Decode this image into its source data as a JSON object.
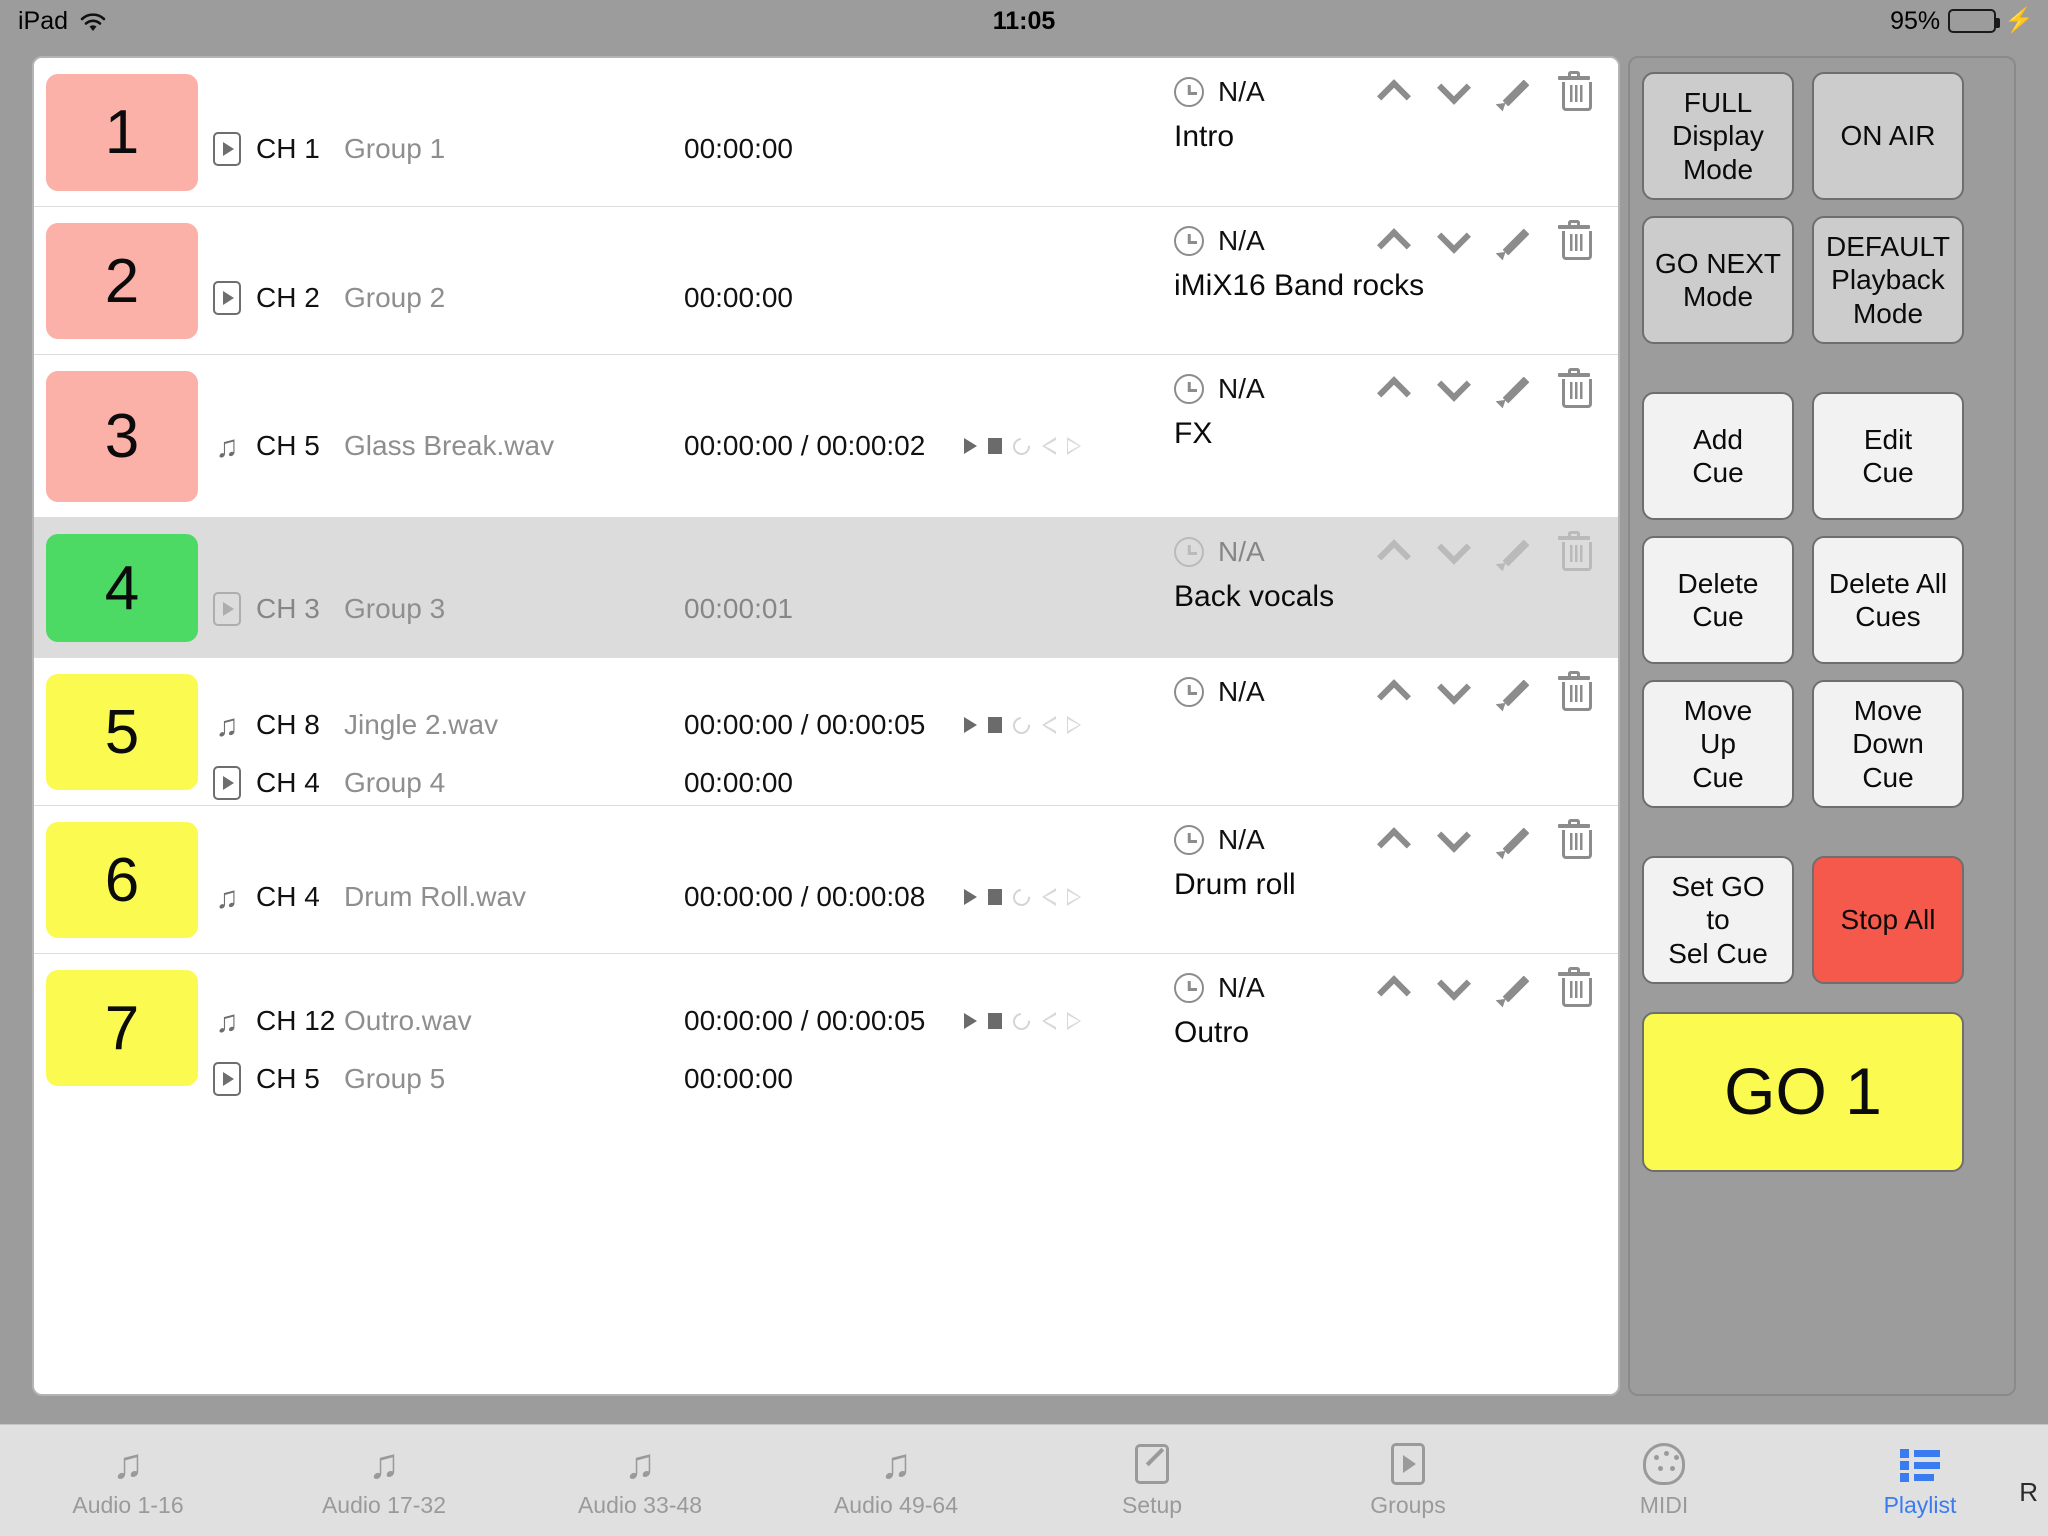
{
  "status_bar": {
    "device": "iPad",
    "wifi_icon": "wifi-icon",
    "time": "11:05",
    "battery_percent": "95%",
    "battery_level": 95,
    "charging_icon": "lightning-bolt-icon",
    "battery_color": "#4cd964"
  },
  "colors": {
    "cue_pink": "#fbb0a8",
    "cue_green": "#4cd964",
    "cue_yellow": "#fafa50",
    "selected_row": "#dcdcdc",
    "stop_all_red": "#f5594b",
    "go_yellow": "#fafa50",
    "active_tab_blue": "#3a7bf0",
    "mode_button_gray": "#cccccc",
    "panel_background": "#9c9c9c"
  },
  "playlist": {
    "rows": [
      {
        "number": "1",
        "badge_color": "#fbb0a8",
        "selected": false,
        "lines": [
          {
            "icon": "video-icon",
            "channel": "CH 1",
            "source": "Group 1",
            "time": "00:00:00",
            "transport": false
          }
        ],
        "schedule_icon": "clock-icon",
        "schedule": "N/A",
        "cue_name": "Intro",
        "actions": [
          "move-up-icon",
          "move-down-icon",
          "edit-icon",
          "delete-icon"
        ]
      },
      {
        "number": "2",
        "badge_color": "#fbb0a8",
        "selected": false,
        "lines": [
          {
            "icon": "video-icon",
            "channel": "CH 2",
            "source": "Group 2",
            "time": "00:00:00",
            "transport": false
          }
        ],
        "schedule_icon": "clock-icon",
        "schedule": "N/A",
        "cue_name": "iMiX16 Band rocks",
        "actions": [
          "move-up-icon",
          "move-down-icon",
          "edit-icon",
          "delete-icon"
        ]
      },
      {
        "number": "3",
        "badge_color": "#fbb0a8",
        "selected": false,
        "lines": [
          {
            "icon": "music-note-icon",
            "channel": "CH 5",
            "source": "Glass Break.wav",
            "time": "00:00:00 / 00:00:02",
            "transport": true
          }
        ],
        "schedule_icon": "clock-icon",
        "schedule": "N/A",
        "cue_name": "FX",
        "actions": [
          "move-up-icon",
          "move-down-icon",
          "edit-icon",
          "delete-icon"
        ]
      },
      {
        "number": "4",
        "badge_color": "#4cd964",
        "selected": true,
        "lines": [
          {
            "icon": "video-icon",
            "channel": "CH 3",
            "source": "Group 3",
            "time": "00:00:01",
            "transport": false
          }
        ],
        "schedule_icon": "clock-icon",
        "schedule": "N/A",
        "cue_name": "Back vocals",
        "actions": [
          "move-up-icon",
          "move-down-icon",
          "edit-icon",
          "delete-icon"
        ]
      },
      {
        "number": "5",
        "badge_color": "#fafa50",
        "selected": false,
        "lines": [
          {
            "icon": "music-note-icon",
            "channel": "CH 8",
            "source": "Jingle 2.wav",
            "time": "00:00:00 / 00:00:05",
            "transport": true
          },
          {
            "icon": "video-icon",
            "channel": "CH 4",
            "source": "Group 4",
            "time": "00:00:00",
            "transport": false
          }
        ],
        "schedule_icon": "clock-icon",
        "schedule": "N/A",
        "cue_name": "",
        "actions": [
          "move-up-icon",
          "move-down-icon",
          "edit-icon",
          "delete-icon"
        ]
      },
      {
        "number": "6",
        "badge_color": "#fafa50",
        "selected": false,
        "lines": [
          {
            "icon": "music-note-icon",
            "channel": "CH 4",
            "source": "Drum Roll.wav",
            "time": "00:00:00 / 00:00:08",
            "transport": true
          }
        ],
        "schedule_icon": "clock-icon",
        "schedule": "N/A",
        "cue_name": "Drum roll",
        "actions": [
          "move-up-icon",
          "move-down-icon",
          "edit-icon",
          "delete-icon"
        ]
      },
      {
        "number": "7",
        "badge_color": "#fafa50",
        "selected": false,
        "lines": [
          {
            "icon": "music-note-icon",
            "channel": "CH 12",
            "source": "Outro.wav",
            "time": "00:00:00 / 00:00:05",
            "transport": true
          },
          {
            "icon": "video-icon",
            "channel": "CH 5",
            "source": "Group 5",
            "time": "00:00:00",
            "transport": false
          }
        ],
        "schedule_icon": "clock-icon",
        "schedule": "N/A",
        "cue_name": "Outro",
        "actions": [
          "move-up-icon",
          "move-down-icon",
          "edit-icon",
          "delete-icon"
        ]
      }
    ]
  },
  "sidebar": {
    "mode_buttons": [
      {
        "label": "FULL\nDisplay\nMode"
      },
      {
        "label": "ON AIR"
      },
      {
        "label": "GO NEXT\nMode"
      },
      {
        "label": "DEFAULT\nPlayback\nMode"
      }
    ],
    "cue_buttons": [
      {
        "label": "Add\nCue"
      },
      {
        "label": "Edit\nCue"
      },
      {
        "label": "Delete\nCue"
      },
      {
        "label": "Delete All\nCues"
      },
      {
        "label": "Move\nUp\nCue"
      },
      {
        "label": "Move\nDown\nCue"
      }
    ],
    "set_go_label": "Set GO\nto\nSel Cue",
    "stop_all_label": "Stop All",
    "go_label": "GO 1"
  },
  "tabbar": {
    "tabs": [
      {
        "label": "Audio 1-16",
        "icon": "music-note-icon",
        "active": false
      },
      {
        "label": "Audio 17-32",
        "icon": "music-note-icon",
        "active": false
      },
      {
        "label": "Audio 33-48",
        "icon": "music-note-icon",
        "active": false
      },
      {
        "label": "Audio 49-64",
        "icon": "music-note-icon",
        "active": false
      },
      {
        "label": "Setup",
        "icon": "setup-pencil-icon",
        "active": false
      },
      {
        "label": "Groups",
        "icon": "groups-video-icon",
        "active": false
      },
      {
        "label": "MIDI",
        "icon": "midi-din-icon",
        "active": false
      },
      {
        "label": "Playlist",
        "icon": "playlist-list-icon",
        "active": true
      }
    ],
    "edge_letter": "R"
  }
}
